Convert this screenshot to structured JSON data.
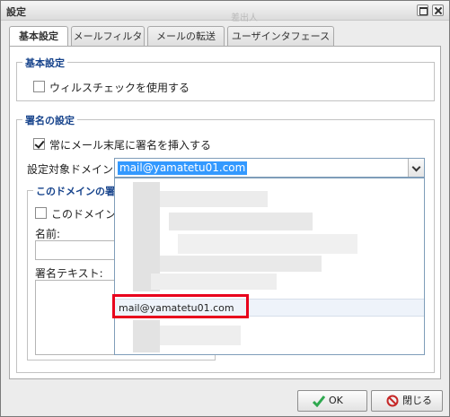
{
  "window": {
    "title": "設定",
    "background_title": "差出人"
  },
  "tabs": [
    {
      "label": "基本設定",
      "active": true
    },
    {
      "label": "メールフィルタ",
      "active": false
    },
    {
      "label": "メールの転送",
      "active": false
    },
    {
      "label": "ユーザインタフェース",
      "active": false
    }
  ],
  "basic_section": {
    "legend": "基本設定",
    "virus_check_label": "ウィルスチェックを使用する",
    "virus_check_checked": false
  },
  "signature_section": {
    "legend": "署名の設定",
    "always_insert_label": "常にメール末尾に署名を挿入する",
    "always_insert_checked": true,
    "domain_label": "設定対象ドメイン:",
    "domain_value": "mail@yamatetu01.com",
    "domain_dropdown": {
      "open": true,
      "highlighted_option": "mail@yamatetu01.com",
      "other_options_obscured": true
    },
    "domain_sub": {
      "legend": "このドメインの署",
      "use_label": "このドメインを",
      "use_checked": false,
      "name_label": "名前:",
      "name_value": "",
      "sig_text_label": "署名テキスト:",
      "sig_text_value": ""
    }
  },
  "footer": {
    "ok_label": "OK",
    "close_label": "閉じる"
  },
  "colors": {
    "legend_text": "#15428b",
    "selection": "#3399ff",
    "highlight_border": "#e8001c",
    "ok_icon": "#2fa84f",
    "close_icon": "#c62828"
  }
}
